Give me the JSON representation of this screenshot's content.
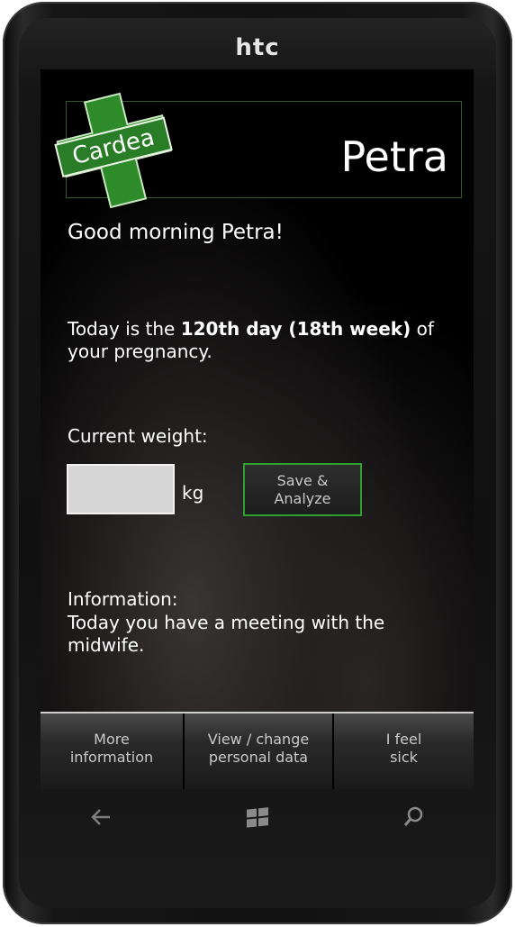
{
  "device": {
    "brand": "htc"
  },
  "header": {
    "logo_text": "Cardea",
    "user_name": "Petra"
  },
  "greeting": "Good morning Petra!",
  "pregnancy": {
    "prefix": "Today is the ",
    "emphasis": "120th day (18th week)",
    "suffix": " of your pregnancy."
  },
  "weight": {
    "label": "Current weight:",
    "value": "",
    "unit": "kg"
  },
  "save_button": {
    "line1": "Save &",
    "line2": "Analyze"
  },
  "information": {
    "title": "Information:",
    "text": "Today you have a meeting with the midwife."
  },
  "app_bar": [
    {
      "line1": "More",
      "line2": "information"
    },
    {
      "line1": "View / change",
      "line2": "personal data"
    },
    {
      "line1": "I feel",
      "line2": "sick"
    }
  ],
  "colors": {
    "accent_green": "#2fa02f",
    "logo_green": "#2e8b2a"
  },
  "hardware_buttons": [
    "back-icon",
    "windows-start-icon",
    "search-icon"
  ]
}
